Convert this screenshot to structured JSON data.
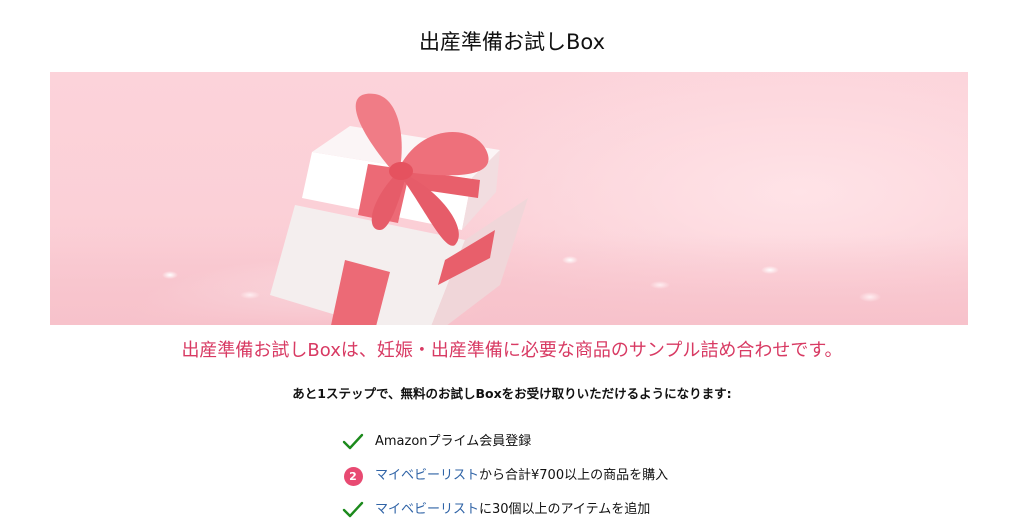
{
  "page": {
    "title": "出産準備お試しBox"
  },
  "hero": {
    "image_icon": "gift-box-illustration"
  },
  "tagline": "出産準備お試しBoxは、妊娠・出産準備に必要な商品のサンプル詰め合わせです。",
  "intro": "あと1ステップで、無料のお試しBoxをお受け取りいただけるようになります:",
  "steps": [
    {
      "status": "done",
      "icon": "check-icon",
      "text": "Amazonプライム会員登録"
    },
    {
      "status": "pending",
      "icon": "number-badge",
      "badge": "2",
      "link": "マイベビーリスト",
      "text": "から合計¥700以上の商品を購入"
    },
    {
      "status": "done",
      "icon": "check-icon",
      "link": "マイベビーリスト",
      "text": "に30個以上のアイテムを追加"
    }
  ],
  "colors": {
    "accent": "#d83a63",
    "link": "#2f63a6",
    "check": "#1c8a1c",
    "badge": "#e84a72"
  }
}
